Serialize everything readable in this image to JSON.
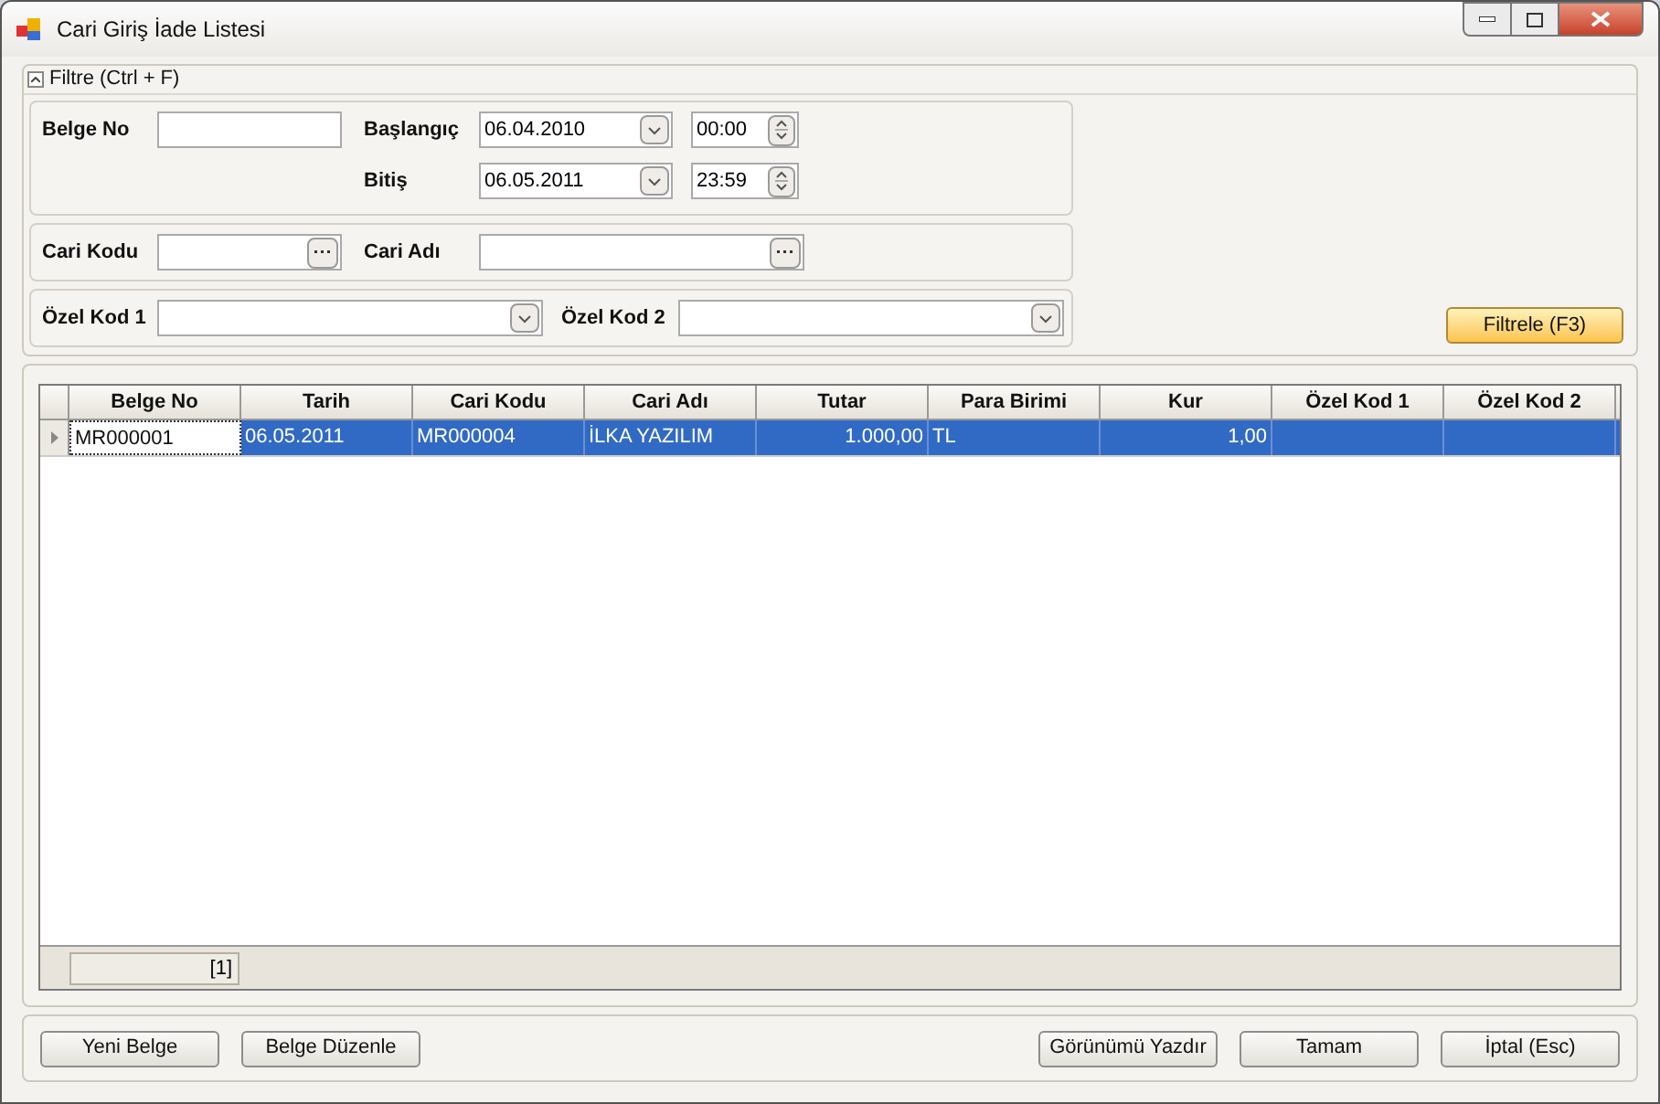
{
  "window": {
    "title": "Cari Giriş İade Listesi"
  },
  "filter": {
    "header": "Filtre (Ctrl + F)",
    "expanded": true,
    "belge_no": {
      "label": "Belge No"
    },
    "start": {
      "label": "Başlangıç",
      "date": "06.04.2010",
      "time": "00:00"
    },
    "end": {
      "label": "Bitiş",
      "date": "06.05.2011",
      "time": "23:59"
    },
    "cari_kodu": {
      "label": "Cari Kodu"
    },
    "cari_adi": {
      "label": "Cari Adı"
    },
    "ozel_kod_1": {
      "label": "Özel Kod 1"
    },
    "ozel_kod_2": {
      "label": "Özel Kod 2"
    },
    "filter_button": "Filtrele (F3)"
  },
  "table": {
    "columns": [
      {
        "label": "Belge No",
        "kind": "text"
      },
      {
        "label": "Tarih",
        "kind": "text"
      },
      {
        "label": "Cari Kodu",
        "kind": "text"
      },
      {
        "label": "Cari Adı",
        "kind": "text"
      },
      {
        "label": "Tutar",
        "kind": "number"
      },
      {
        "label": "Para Birimi",
        "kind": "text"
      },
      {
        "label": "Kur",
        "kind": "number"
      },
      {
        "label": "Özel Kod 1",
        "kind": "text"
      },
      {
        "label": "Özel Kod 2",
        "kind": "text"
      }
    ],
    "rows": [
      {
        "selected": true,
        "cells": [
          {
            "text": "MR000001",
            "focused": true
          },
          {
            "text": "06.05.2011",
            "focused": false
          },
          {
            "text": "MR000004",
            "focused": false
          },
          {
            "text": "İLKA YAZILIM",
            "focused": false
          },
          {
            "text": "1.000,00",
            "focused": false
          },
          {
            "text": "TL",
            "focused": false
          },
          {
            "text": "1,00",
            "focused": false
          },
          {
            "focused": false
          },
          {
            "focused": false
          }
        ]
      }
    ],
    "footer_count": "[1]"
  },
  "buttons_left": [
    "Yeni Belge",
    "Belge Düzenle"
  ],
  "buttons_right": [
    "Görünümü Yazdır",
    "Tamam",
    "İptal (Esc)"
  ]
}
